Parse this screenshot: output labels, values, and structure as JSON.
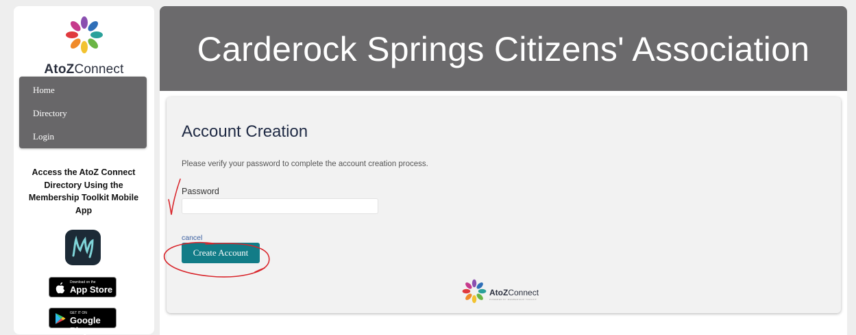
{
  "brand": {
    "name_bold": "AtoZ",
    "name_regular": "Connect"
  },
  "nav": {
    "items": [
      {
        "label": "Home"
      },
      {
        "label": "Directory"
      },
      {
        "label": "Login"
      }
    ]
  },
  "promo": {
    "text": "Access the AtoZ Connect Directory Using the Membership Toolkit Mobile App"
  },
  "stores": {
    "apple": {
      "small": "Download on the",
      "big": "App Store"
    },
    "google": {
      "small": "GET IT ON",
      "big": "Google Play"
    }
  },
  "header": {
    "title": "Carderock Springs Citizens' Association"
  },
  "form": {
    "title": "Account Creation",
    "description": "Please verify your password to complete the account creation process.",
    "password_label": "Password",
    "password_value": "",
    "cancel_label": "cancel",
    "submit_label": "Create Account"
  },
  "footer": {
    "brand_bold": "AtoZ",
    "brand_regular": "Connect",
    "tagline": "POWERED BY MEMBERSHIP TOOLKIT"
  },
  "colors": {
    "banner": "#6b6a6c",
    "nav": "#686769",
    "accent": "#127c87",
    "annotation": "#d9262c"
  }
}
